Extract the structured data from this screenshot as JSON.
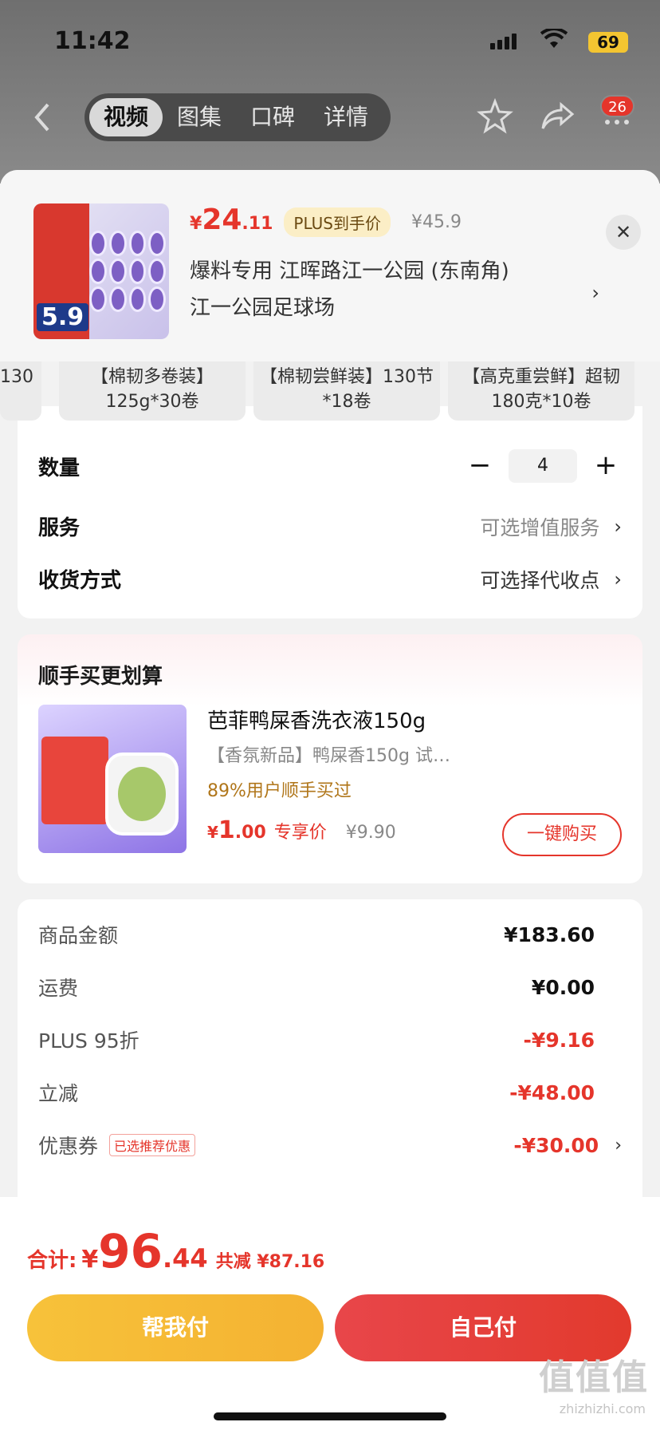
{
  "status": {
    "time": "11:42",
    "battery": "69"
  },
  "nav": {
    "tabs": [
      "视频",
      "图集",
      "口碑",
      "详情"
    ],
    "active_tab": 0,
    "badge": "26"
  },
  "product": {
    "price_symbol": "¥",
    "price_int": "24",
    "price_dec": ".11",
    "plus_tag": "PLUS到手价",
    "orig_price": "¥45.9",
    "address_line1": "爆料专用  江晖路江一公园 (东南角)",
    "address_line2": "江一公园足球场",
    "thumb_price": "5.9"
  },
  "specs": [
    {
      "text": "130"
    },
    {
      "text": "【棉韧多卷装】125g*30卷"
    },
    {
      "text": "【棉韧尝鲜装】130节*18卷"
    },
    {
      "text": "【高克重尝鲜】超韧180克*10卷"
    }
  ],
  "options": {
    "qty_label": "数量",
    "qty_value": "4",
    "minus": "−",
    "plus": "+",
    "service_label": "服务",
    "service_value": "可选增值服务",
    "delivery_label": "收货方式",
    "delivery_value": "可选择代收点"
  },
  "upsell": {
    "title": "顺手买更划算",
    "name": "芭菲鸭屎香洗衣液150g",
    "subtitle": "【香氛新品】鸭屎香150g 试…",
    "rate": "89%用户顺手买过",
    "price_symbol": "¥",
    "price_int": "1",
    "price_dec": ".00",
    "exclusive": "专享价",
    "orig_price": "¥9.90",
    "buy_label": "一键购买"
  },
  "summary": {
    "rows": [
      {
        "label": "商品金额",
        "value": "¥183.60"
      },
      {
        "label": "运费",
        "value": "¥0.00"
      },
      {
        "label": "PLUS 95折",
        "value": "-¥9.16"
      },
      {
        "label": "立减",
        "value": "-¥48.00"
      },
      {
        "label": "优惠券",
        "value": "-¥30.00",
        "tag": "已选推荐优惠"
      }
    ]
  },
  "footer": {
    "total_label": "合计:",
    "total_symbol": "¥",
    "total_int": "96",
    "total_dec": ".44",
    "saved": "共减 ¥87.16",
    "help_pay": "帮我付",
    "self_pay": "自己付",
    "watermark": "值值值",
    "watermark_sub": "zhizhizhi.com"
  },
  "colors": {
    "accent": "#e5352b",
    "gold": "#f7c23a",
    "plus_bg": "#fbeec6"
  }
}
